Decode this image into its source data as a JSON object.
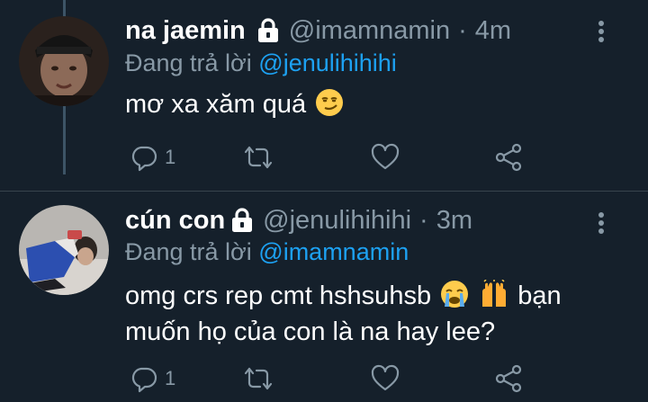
{
  "tweets": [
    {
      "display_name": "na jaemin",
      "handle": "@imamnamin",
      "separator": "·",
      "time": "4m",
      "reply_prefix": "Đang trả lời",
      "reply_to": "@jenulihihihi",
      "text": "mơ xa xăm quá",
      "emojis": [
        "smirking-face"
      ],
      "reply_count": "1",
      "protected": true,
      "icons": {
        "reply": "reply-icon",
        "retweet": "retweet-icon",
        "like": "heart-icon",
        "share": "share-icon",
        "more": "more-vertical-icon",
        "lock": "lock-icon"
      }
    },
    {
      "display_name": "cún con",
      "handle": "@jenulihihihi",
      "separator": "·",
      "time": "3m",
      "reply_prefix": "Đang trả lời",
      "reply_to": "@imamnamin",
      "text_part1": "omg crs rep cmt hshsuhsb",
      "text_part2": "bạn muốn họ của con là na hay lee?",
      "emojis": [
        "loudly-crying-face",
        "raising-hands"
      ],
      "reply_count": "1",
      "protected": true
    }
  ],
  "colors": {
    "background": "#15202b",
    "primary_text": "#ffffff",
    "secondary_text": "#8899a6",
    "accent": "#1da1f2",
    "divider": "#38444d",
    "thread_line": "#3d5466"
  }
}
